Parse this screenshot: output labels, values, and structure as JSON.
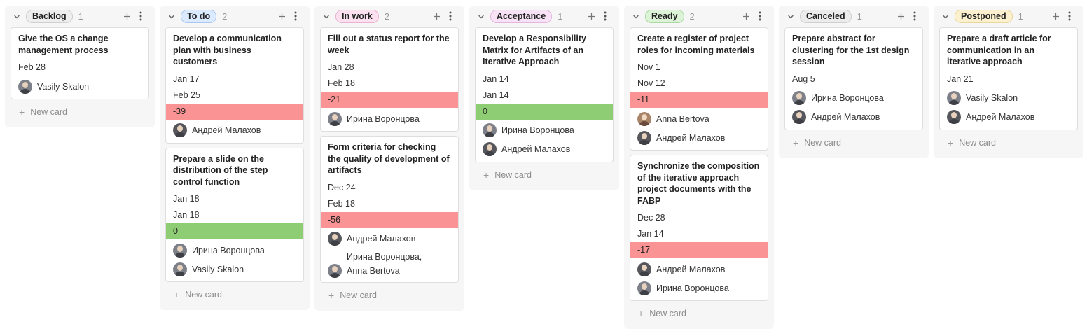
{
  "new_card_label": "New card",
  "columns": [
    {
      "name": "Backlog",
      "count": "1",
      "badge_bg": "#eeeeee",
      "badge_border": "#cfcfcf",
      "cards": [
        {
          "title": "Give the OS a change management process",
          "dates": [
            "Feb 28"
          ],
          "delta": null,
          "people": [
            {
              "name": "Vasily Skalon"
            }
          ]
        }
      ]
    },
    {
      "name": "To do",
      "count": "2",
      "badge_bg": "#dceaff",
      "badge_border": "#a9c7f0",
      "cards": [
        {
          "title": "Develop a communication plan with business customers",
          "dates": [
            "Jan 17",
            "Feb 25"
          ],
          "delta": {
            "value": "-39",
            "status": "negative",
            "color": "#fa9393"
          },
          "people": [
            {
              "name": "Андрей Малахов"
            }
          ]
        },
        {
          "title": "Prepare a slide on the distribution of the step control function",
          "dates": [
            "Jan 18",
            "Jan 18"
          ],
          "delta": {
            "value": "0",
            "status": "positive",
            "color": "#8fcd74"
          },
          "people": [
            {
              "name": "Ирина Воронцова"
            },
            {
              "name": "Vasily Skalon"
            }
          ]
        }
      ]
    },
    {
      "name": "In work",
      "count": "2",
      "badge_bg": "#fbe1f0",
      "badge_border": "#eab3d3",
      "cards": [
        {
          "title": "Fill out a status report for the week",
          "dates": [
            "Jan 28",
            "Feb 18"
          ],
          "delta": {
            "value": "-21",
            "status": "negative",
            "color": "#fa9393"
          },
          "people": [
            {
              "name": "Ирина Воронцова"
            }
          ]
        },
        {
          "title": "Form criteria for checking the quality of development of artifacts",
          "dates": [
            "Dec 24",
            "Feb 18"
          ],
          "delta": {
            "value": "-56",
            "status": "negative",
            "color": "#fa9393"
          },
          "people": [
            {
              "name": "Андрей Малахов"
            },
            {
              "name": "Ирина Воронцова,",
              "name2": "Anna Bertova"
            }
          ]
        }
      ]
    },
    {
      "name": "Acceptance",
      "count": "1",
      "badge_bg": "#f8e3f6",
      "badge_border": "#e4b5df",
      "cards": [
        {
          "title": "Develop a Responsibility Matrix for Artifacts of an Iterative Approach",
          "dates": [
            "Jan 14",
            "Jan 14"
          ],
          "delta": {
            "value": "0",
            "status": "positive",
            "color": "#8fcd74"
          },
          "people": [
            {
              "name": "Ирина Воронцова"
            },
            {
              "name": "Андрей Малахов"
            }
          ]
        }
      ]
    },
    {
      "name": "Ready",
      "count": "2",
      "badge_bg": "#ddf3d8",
      "badge_border": "#a9d9a0",
      "cards": [
        {
          "title": "Create a register of project roles for incoming materials",
          "dates": [
            "Nov 1",
            "Nov 12"
          ],
          "delta": {
            "value": "-11",
            "status": "negative",
            "color": "#fa9393"
          },
          "people": [
            {
              "name": "Anna Bertova"
            },
            {
              "name": "Андрей Малахов"
            }
          ]
        },
        {
          "title": "Synchronize the composition of the iterative approach project documents with the FABP",
          "dates": [
            "Dec 28",
            "Jan 14"
          ],
          "delta": {
            "value": "-17",
            "status": "negative",
            "color": "#fa9393"
          },
          "people": [
            {
              "name": "Андрей Малахов"
            },
            {
              "name": "Ирина Воронцова"
            }
          ]
        }
      ]
    },
    {
      "name": "Canceled",
      "count": "1",
      "badge_bg": "#ececec",
      "badge_border": "#cfcfcf",
      "cards": [
        {
          "title": "Prepare abstract for clustering for the 1st design session",
          "dates": [
            "Aug 5"
          ],
          "delta": null,
          "people": [
            {
              "name": "Ирина Воронцова"
            },
            {
              "name": "Андрей Малахов"
            }
          ]
        }
      ]
    },
    {
      "name": "Postponed",
      "count": "1",
      "badge_bg": "#fcf1cf",
      "badge_border": "#ead79a",
      "cards": [
        {
          "title": "Prepare a draft article for communication in an iterative approach",
          "dates": [
            "Jan 21"
          ],
          "delta": null,
          "people": [
            {
              "name": "Vasily Skalon"
            },
            {
              "name": "Андрей Малахов"
            }
          ]
        }
      ]
    }
  ]
}
